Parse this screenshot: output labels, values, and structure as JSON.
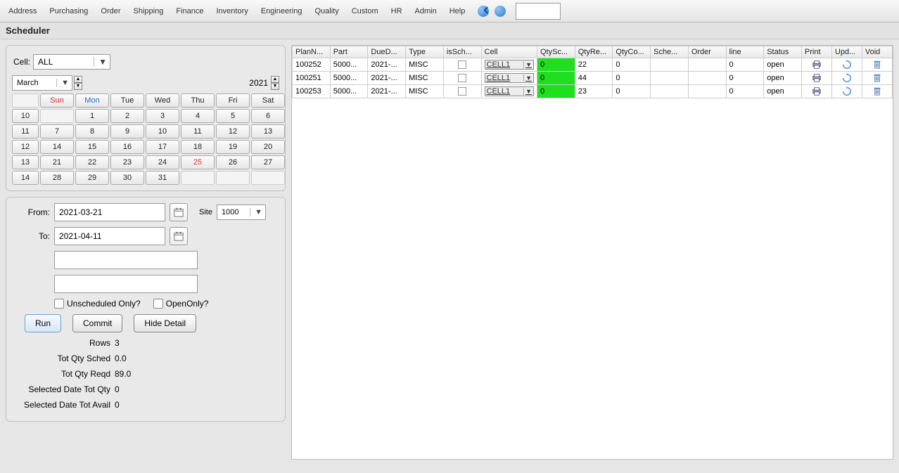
{
  "menu": [
    "Address",
    "Purchasing",
    "Order",
    "Shipping",
    "Finance",
    "Inventory",
    "Engineering",
    "Quality",
    "Custom",
    "HR",
    "Admin",
    "Help"
  ],
  "searchValue": "",
  "title": "Scheduler",
  "cellLabel": "Cell:",
  "cellValue": "ALL",
  "calendar": {
    "month": "March",
    "year": "2021",
    "daysOfWeek": [
      "Sun",
      "Mon",
      "Tue",
      "Wed",
      "Thu",
      "Fri",
      "Sat"
    ],
    "weekNumbers": [
      "",
      "10",
      "11",
      "12",
      "13",
      "14"
    ],
    "rows": [
      [
        "",
        "1",
        "2",
        "3",
        "4",
        "5",
        "6"
      ],
      [
        "7",
        "8",
        "9",
        "10",
        "11",
        "12",
        "13"
      ],
      [
        "14",
        "15",
        "16",
        "17",
        "18",
        "19",
        "20"
      ],
      [
        "21",
        "22",
        "23",
        "24",
        "25",
        "26",
        "27"
      ],
      [
        "28",
        "29",
        "30",
        "31",
        "",
        "",
        ""
      ]
    ],
    "todayRow": 3,
    "todayCol": 4
  },
  "filter": {
    "fromLabel": "From:",
    "fromValue": "2021-03-21",
    "toLabel": "To:",
    "toValue": "2021-04-11",
    "siteLabel": "Site",
    "siteValue": "1000",
    "unschedLabel": "Unscheduled Only?",
    "openOnlyLabel": "OpenOnly?",
    "runLabel": "Run",
    "commitLabel": "Commit",
    "hideDetailLabel": "Hide Detail"
  },
  "stats": {
    "rowsLabel": "Rows",
    "rowsValue": "3",
    "totSchedLabel": "Tot Qty Sched",
    "totSchedValue": "0.0",
    "totReqdLabel": "Tot Qty Reqd",
    "totReqdValue": "89.0",
    "selQtyLabel": "Selected Date Tot Qty",
    "selQtyValue": "0",
    "selAvailLabel": "Selected Date Tot Avail",
    "selAvailValue": "0"
  },
  "gridHeaders": [
    "PlanN...",
    "Part",
    "DueD...",
    "Type",
    "isSch...",
    "Cell",
    "QtySc...",
    "QtyRe...",
    "QtyCo...",
    "Sche...",
    "Order",
    "line",
    "Status",
    "Print",
    "Upd...",
    "Void"
  ],
  "gridRows": [
    {
      "plan": "100252",
      "part": "5000...",
      "due": "2021-...",
      "type": "MISC",
      "isSch": false,
      "cell": "CELL1",
      "qtySc": "0",
      "qtyRe": "22",
      "qtyCo": "0",
      "sche": "",
      "order": "",
      "line": "0",
      "status": "open"
    },
    {
      "plan": "100251",
      "part": "5000...",
      "due": "2021-...",
      "type": "MISC",
      "isSch": false,
      "cell": "CELL1",
      "qtySc": "0",
      "qtyRe": "44",
      "qtyCo": "0",
      "sche": "",
      "order": "",
      "line": "0",
      "status": "open"
    },
    {
      "plan": "100253",
      "part": "5000...",
      "due": "2021-...",
      "type": "MISC",
      "isSch": false,
      "cell": "CELL1",
      "qtySc": "0",
      "qtyRe": "23",
      "qtyCo": "0",
      "sche": "",
      "order": "",
      "line": "0",
      "status": "open"
    }
  ]
}
